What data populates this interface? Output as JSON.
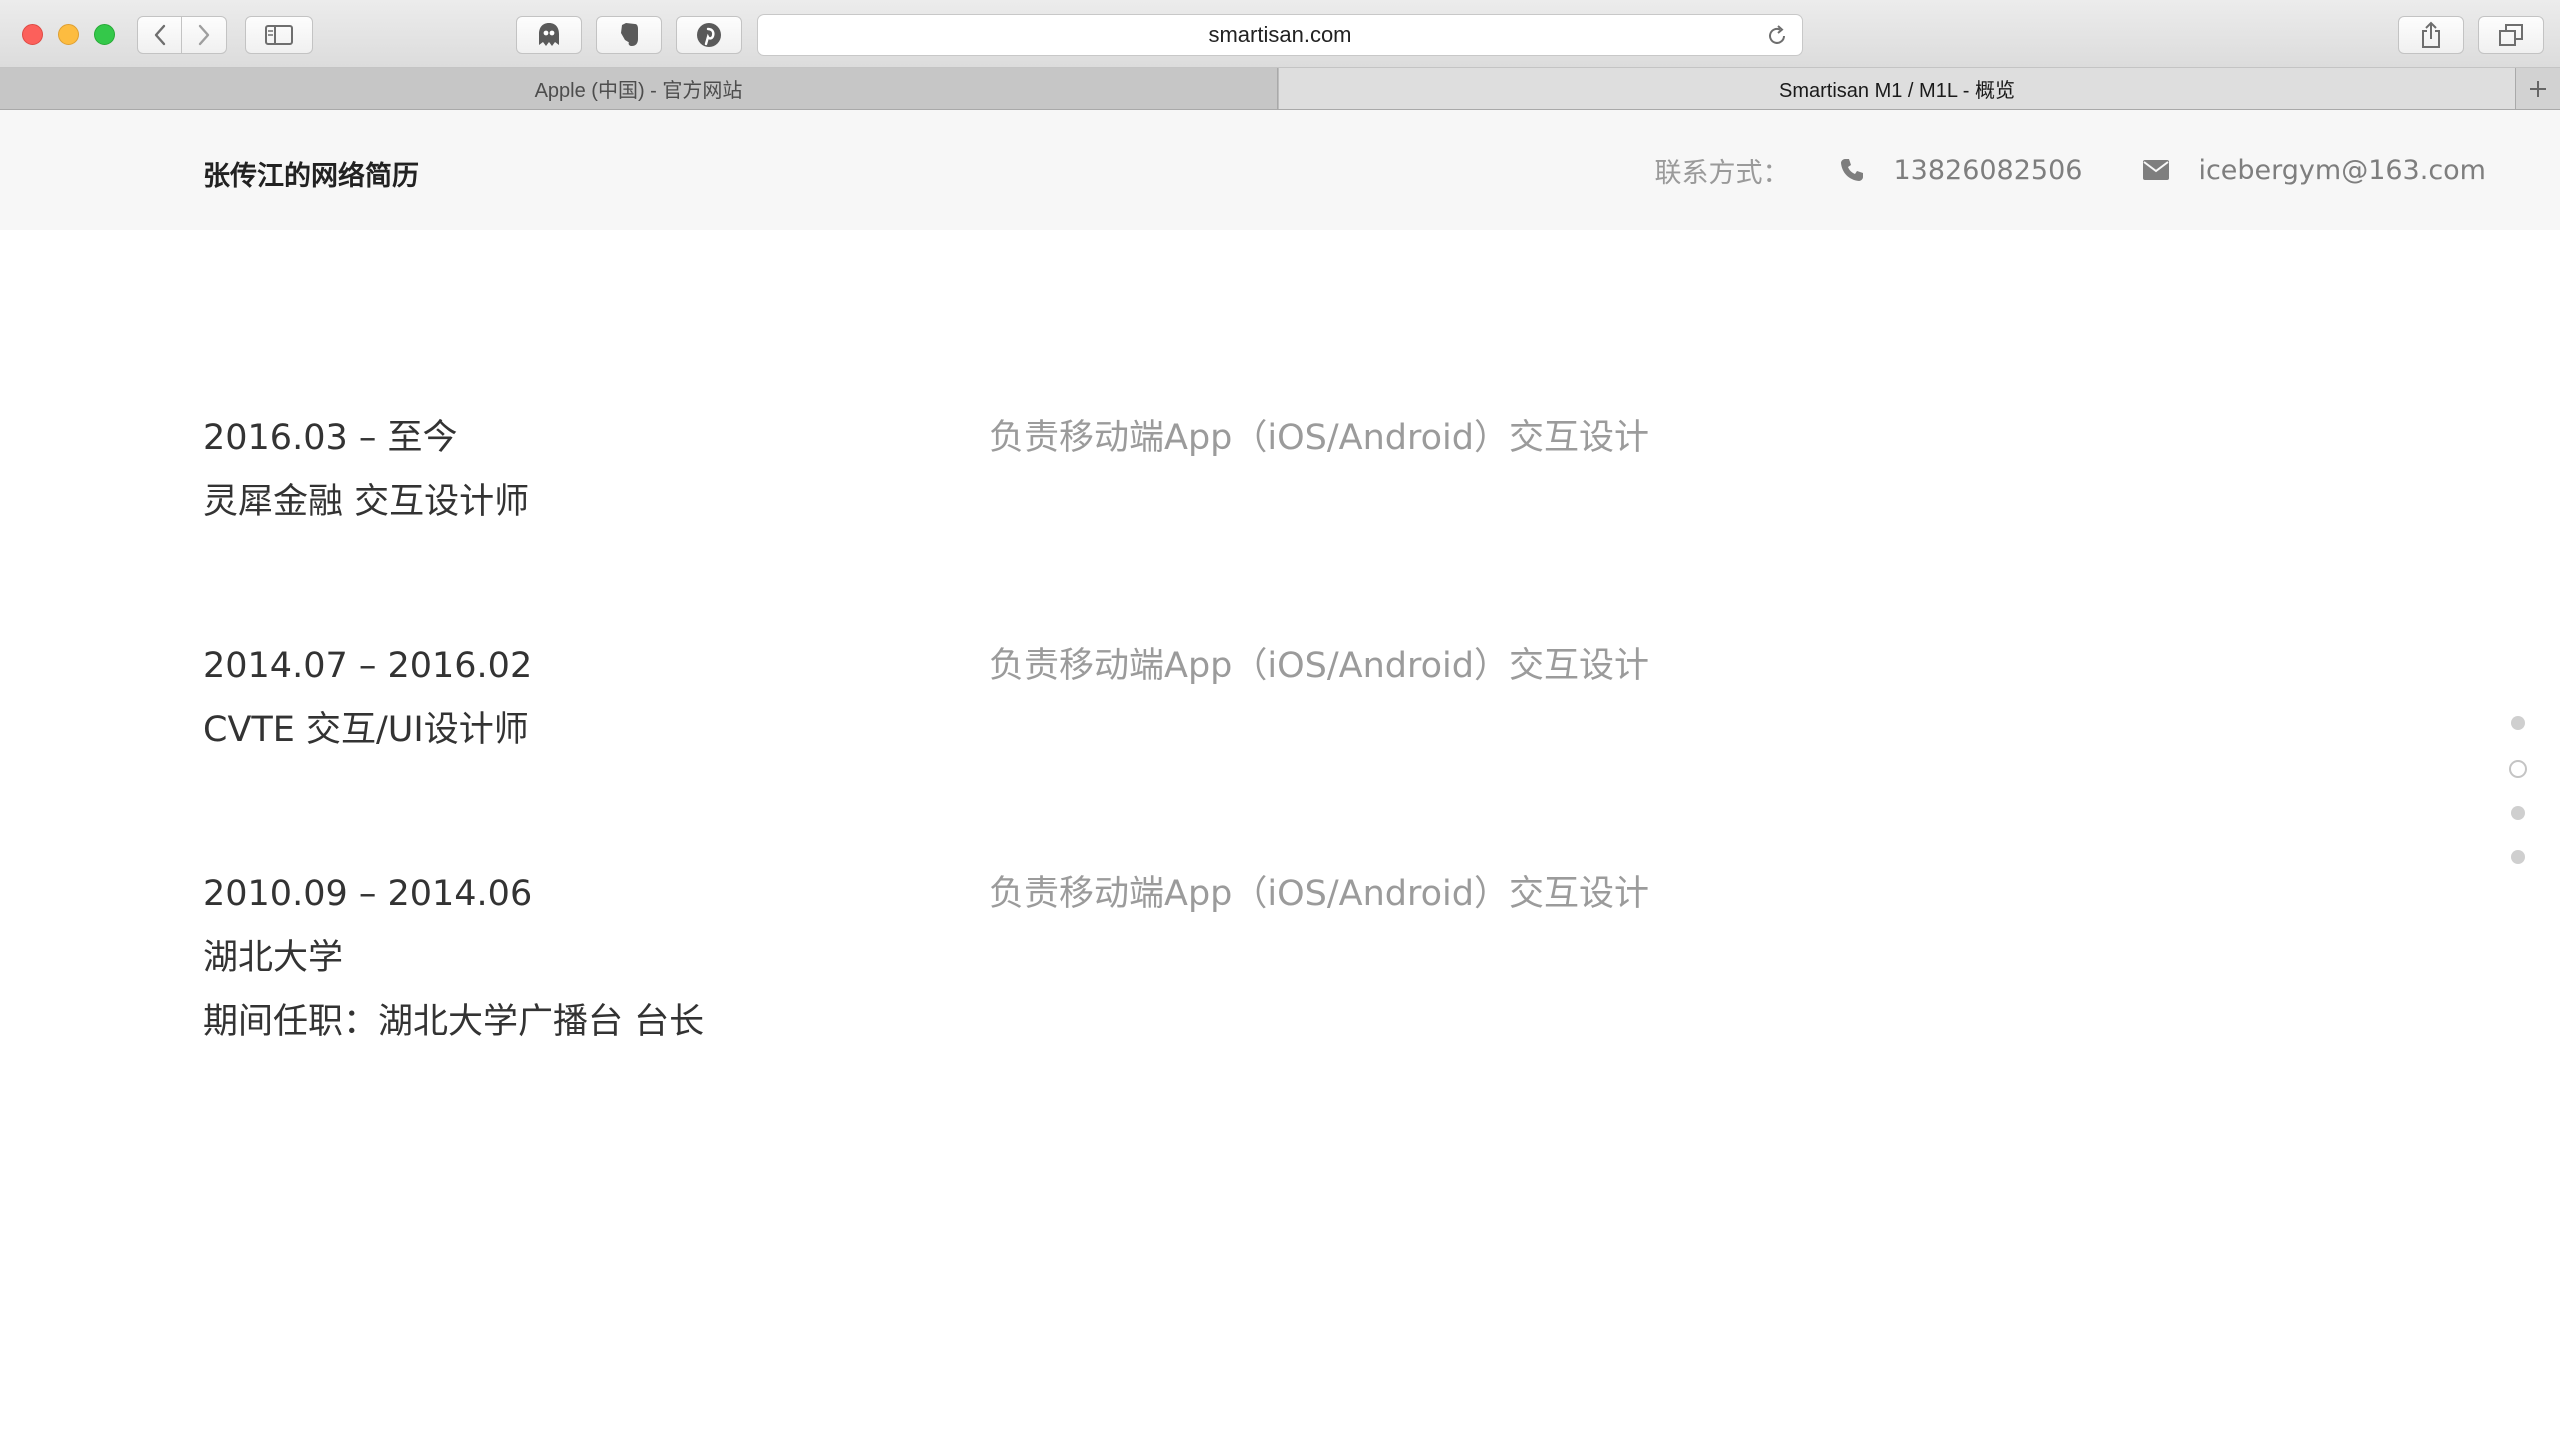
{
  "browser": {
    "url": "smartisan.com",
    "tabs": [
      {
        "label": "Apple (中国) - 官方网站",
        "active": false
      },
      {
        "label": "Smartisan M1 / M1L - 概览",
        "active": true
      }
    ],
    "icons": [
      "chevron-left-icon",
      "chevron-right-icon",
      "sidebar-icon",
      "ghostery-icon",
      "evernote-icon",
      "pinterest-icon",
      "reload-icon",
      "share-icon",
      "tabs-icon",
      "plus-icon"
    ]
  },
  "header": {
    "title": "张传江的网络简历",
    "contact_label": "联系方式：",
    "phone": "13826082506",
    "email": "icebergym@163.com"
  },
  "timeline": [
    {
      "period": "2016.03 – 至今",
      "role": "灵犀金融 交互设计师",
      "description": "负责移动端App（iOS/Android）交互设计"
    },
    {
      "period": "2014.07 – 2016.02",
      "role": "CVTE 交互/UI设计师",
      "description": "负责移动端App（iOS/Android）交互设计"
    },
    {
      "period": "2010.09 – 2014.06",
      "role": "湖北大学",
      "extra": "期间任职：湖北大学广播台 台长",
      "description": "负责移动端App（iOS/Android）交互设计"
    }
  ],
  "side_nav": {
    "count": 4,
    "active_index": 1
  },
  "colors": {
    "header_bg": "#f7f7f7",
    "text_primary": "#333333",
    "text_secondary": "#9b9b9b"
  }
}
